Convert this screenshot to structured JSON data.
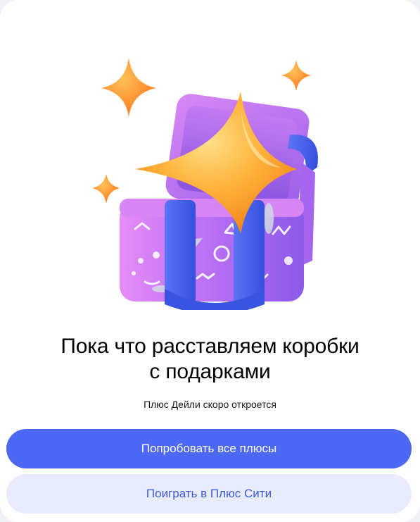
{
  "content": {
    "title_line1": "Пока что расставляем коробки",
    "title_line2": "с подарками",
    "subtitle": "Плюс Дейли скоро откроется"
  },
  "buttons": {
    "primary_label": "Попробовать все плюсы",
    "secondary_label": "Поиграть в Плюс Сити"
  },
  "illustration": {
    "icon": "gift-box-with-stars-icon"
  },
  "colors": {
    "primary_button": "#4c68f5",
    "secondary_button_bg": "#e9ecfd",
    "secondary_button_text": "#3d5bd9",
    "box_purple": "#b86ef2",
    "ribbon_blue": "#4a62f0",
    "star_orange": "#ff8a1f"
  }
}
